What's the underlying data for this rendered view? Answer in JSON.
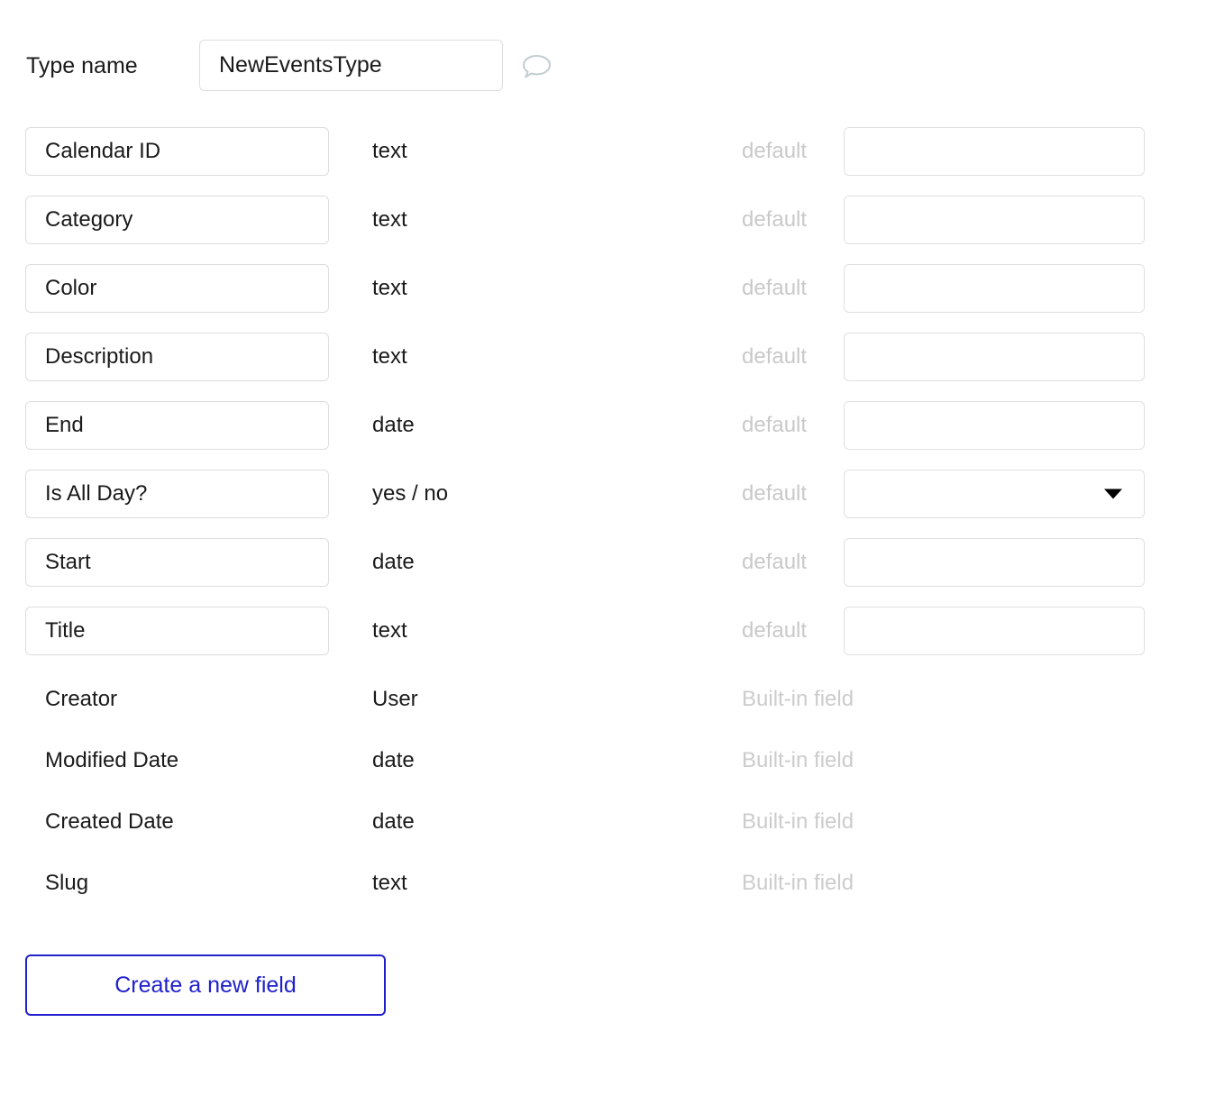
{
  "header": {
    "type_name_label": "Type name",
    "type_name_value": "NewEventsType",
    "type_name_placeholder": "",
    "comment_icon": "speech-bubble-icon"
  },
  "columns": {
    "default_label": "default",
    "builtin_label": "Built-in field"
  },
  "fields": [
    {
      "name": "Calendar ID",
      "type": "text",
      "default_label": "default",
      "control": "input",
      "default_value": ""
    },
    {
      "name": "Category",
      "type": "text",
      "default_label": "default",
      "control": "input",
      "default_value": ""
    },
    {
      "name": "Color",
      "type": "text",
      "default_label": "default",
      "control": "input",
      "default_value": ""
    },
    {
      "name": "Description",
      "type": "text",
      "default_label": "default",
      "control": "input",
      "default_value": ""
    },
    {
      "name": "End",
      "type": "date",
      "default_label": "default",
      "control": "input",
      "default_value": ""
    },
    {
      "name": "Is All Day?",
      "type": "yes / no",
      "default_label": "default",
      "control": "select",
      "default_value": ""
    },
    {
      "name": "Start",
      "type": "date",
      "default_label": "default",
      "control": "input",
      "default_value": ""
    },
    {
      "name": "Title",
      "type": "text",
      "default_label": "default",
      "control": "input",
      "default_value": ""
    }
  ],
  "builtin_fields": [
    {
      "name": "Creator",
      "type": "User",
      "tag": "Built-in field"
    },
    {
      "name": "Modified Date",
      "type": "date",
      "tag": "Built-in field"
    },
    {
      "name": "Created Date",
      "type": "date",
      "tag": "Built-in field"
    },
    {
      "name": "Slug",
      "type": "text",
      "tag": "Built-in field"
    }
  ],
  "actions": {
    "create_field_label": "Create a new field"
  },
  "colors": {
    "accent_blue": "#2020cc",
    "muted_gray": "#c9c9c9",
    "border_gray": "#dddddd",
    "text_dark": "#1a1a1a"
  }
}
